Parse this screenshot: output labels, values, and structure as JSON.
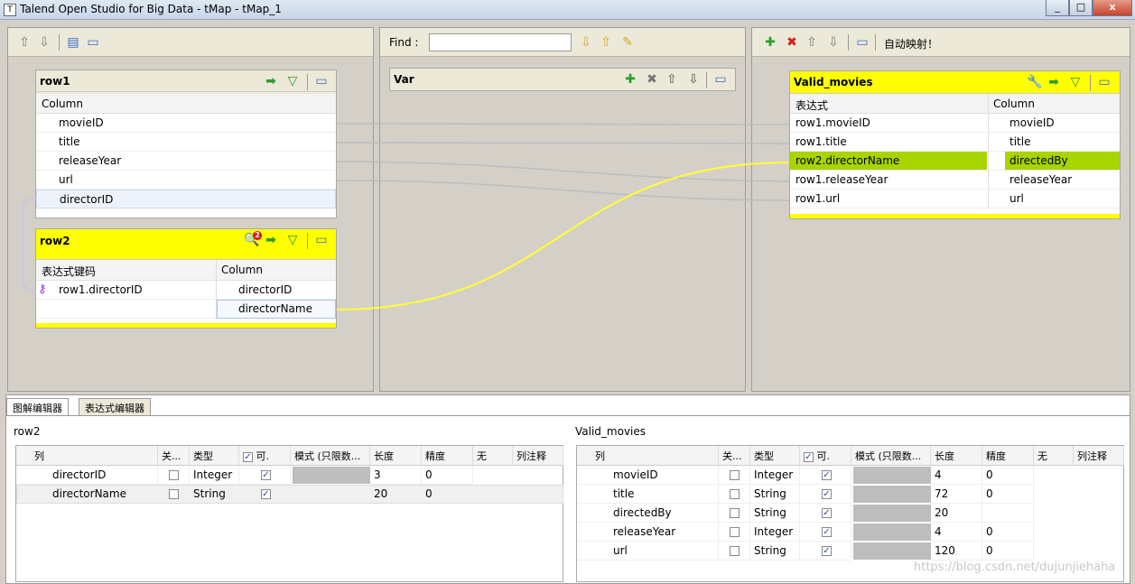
{
  "window": {
    "title": "Talend Open Studio for Big Data - tMap - tMap_1",
    "min": "_",
    "max": "□",
    "close": "x"
  },
  "icons": {
    "up": "arrow-up-icon",
    "down": "arrow-down-icon",
    "add": "plus-icon",
    "remove": "x-icon",
    "key": "key-icon",
    "filter": "filter-icon",
    "wrench": "wrench-icon"
  },
  "find": {
    "label": "Find :",
    "value": ""
  },
  "output_toolbar": {
    "auto_map": "自动映射！"
  },
  "row1": {
    "title": "row1",
    "column_header": "Column",
    "columns": [
      "movieID",
      "title",
      "releaseYear",
      "url",
      "directorID"
    ]
  },
  "row2": {
    "title": "row2",
    "expr_header": "表达式键码",
    "column_header": "Column",
    "key_expr": "row1.directorID",
    "columns": [
      "directorID",
      "directorName"
    ],
    "badge": "2"
  },
  "var": {
    "title": "Var"
  },
  "valid_movies": {
    "title": "Valid_movies",
    "expr_header": "表达式",
    "column_header": "Column",
    "rows": [
      {
        "expr": "row1.movieID",
        "col": "movieID"
      },
      {
        "expr": "row1.title",
        "col": "title"
      },
      {
        "expr": "row2.directorName",
        "col": "directedBy"
      },
      {
        "expr": "row1.releaseYear",
        "col": "releaseYear"
      },
      {
        "expr": "row1.url",
        "col": "url"
      }
    ]
  },
  "tabs": {
    "schema": "图解编辑器",
    "expr": "表达式编辑器"
  },
  "schema_left": {
    "title": "row2",
    "headers": [
      "列",
      "关...",
      "类型",
      "可.",
      "模式 (只限数...",
      "长度",
      "精度",
      "无",
      "列注释"
    ],
    "rows": [
      {
        "name": "directorID",
        "type": "Integer",
        "length": "3",
        "precision": "0"
      },
      {
        "name": "directorName",
        "type": "String",
        "length": "20",
        "precision": "0"
      }
    ]
  },
  "schema_right": {
    "title": "Valid_movies",
    "headers": [
      "列",
      "关...",
      "类型",
      "可.",
      "模式 (只限数...",
      "长度",
      "精度",
      "无",
      "列注释"
    ],
    "rows": [
      {
        "name": "movieID",
        "type": "Integer",
        "length": "4",
        "precision": "0"
      },
      {
        "name": "title",
        "type": "String",
        "length": "72",
        "precision": "0"
      },
      {
        "name": "directedBy",
        "type": "String",
        "length": "20",
        "precision": ""
      },
      {
        "name": "releaseYear",
        "type": "Integer",
        "length": "4",
        "precision": "0"
      },
      {
        "name": "url",
        "type": "String",
        "length": "120",
        "precision": "0"
      }
    ]
  },
  "watermark": "https://blog.csdn.net/dujunjiehaha",
  "colors": {
    "yellow": "#ffff00",
    "highlight": "#a8d400",
    "link": "#ffff33"
  }
}
